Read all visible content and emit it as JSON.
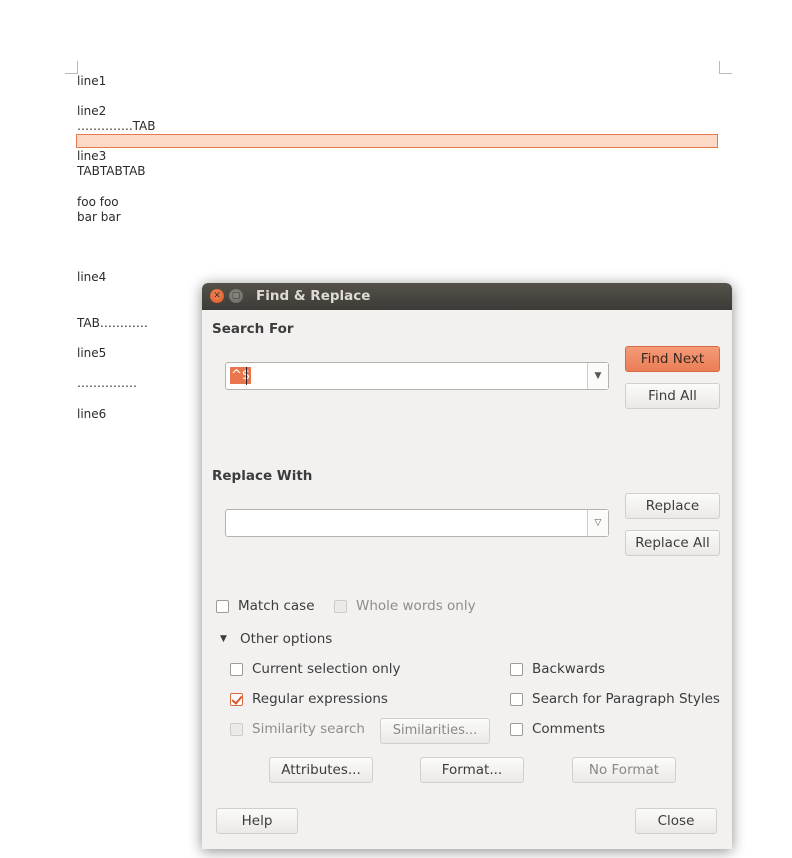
{
  "document": {
    "lines": [
      "line1",
      "line2",
      "…………..TAB",
      "line3",
      "TABTABTAB",
      "foo foo",
      "bar bar",
      "line4",
      "TAB…………",
      "line5",
      "……………",
      "line6"
    ]
  },
  "dialog": {
    "title": "Find & Replace",
    "search_heading": "Search For",
    "search_value": "^$",
    "replace_heading": "Replace With",
    "replace_value": "",
    "buttons": {
      "find_next": "Find Next",
      "find_all": "Find All",
      "replace": "Replace",
      "replace_all": "Replace All",
      "attributes": "Attributes...",
      "format": "Format...",
      "no_format": "No Format",
      "similarities": "Similarities...",
      "help": "Help",
      "close": "Close"
    },
    "options": {
      "match_case": "Match case",
      "whole_words": "Whole words only",
      "other_options": "Other options",
      "current_selection": "Current selection only",
      "regular_expressions": "Regular expressions",
      "similarity_search": "Similarity search",
      "backwards": "Backwards",
      "paragraph_styles": "Search for Paragraph Styles",
      "comments": "Comments"
    },
    "state": {
      "regular_expressions_checked": true,
      "match_case_checked": false,
      "whole_words_enabled": false,
      "similarity_enabled": false
    }
  },
  "colors": {
    "accent": "#ea7e56",
    "highlight": "#fcd9c7",
    "titlebar": "#3d3b37"
  },
  "icons": {
    "close": "close-icon",
    "minimize": "minimize-icon",
    "dropdown": "chevron-down-icon",
    "expander": "triangle-down-icon"
  }
}
